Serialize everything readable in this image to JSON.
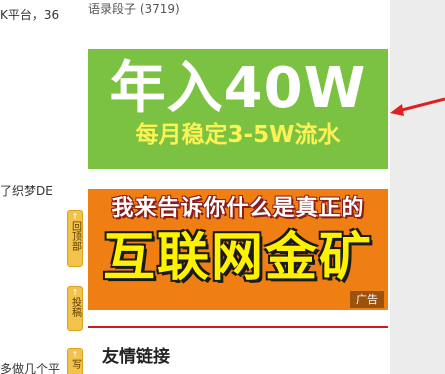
{
  "left_fragments": {
    "line1": "K平台，36",
    "line2": "了织梦DE",
    "line3": "多做几个平"
  },
  "side_buttons": [
    {
      "icon": "↑",
      "label": "回顶部"
    },
    {
      "icon": "↑",
      "label": "投稿"
    },
    {
      "icon": "↑",
      "label": "写"
    }
  ],
  "top_item": "语录段子 (3719)",
  "ad1": {
    "headline": "年入40W",
    "subline": "每月稳定3-5W流水"
  },
  "ad2": {
    "line1": "我来告诉你什么是真正的",
    "headline": "互联网金矿",
    "tag": "广告"
  },
  "section": {
    "title": "友情链接"
  },
  "colors": {
    "ad1_bg": "#7cc242",
    "ad2_bg": "#ef7f13",
    "section_border": "#c81d25",
    "arrow": "#e02020"
  }
}
